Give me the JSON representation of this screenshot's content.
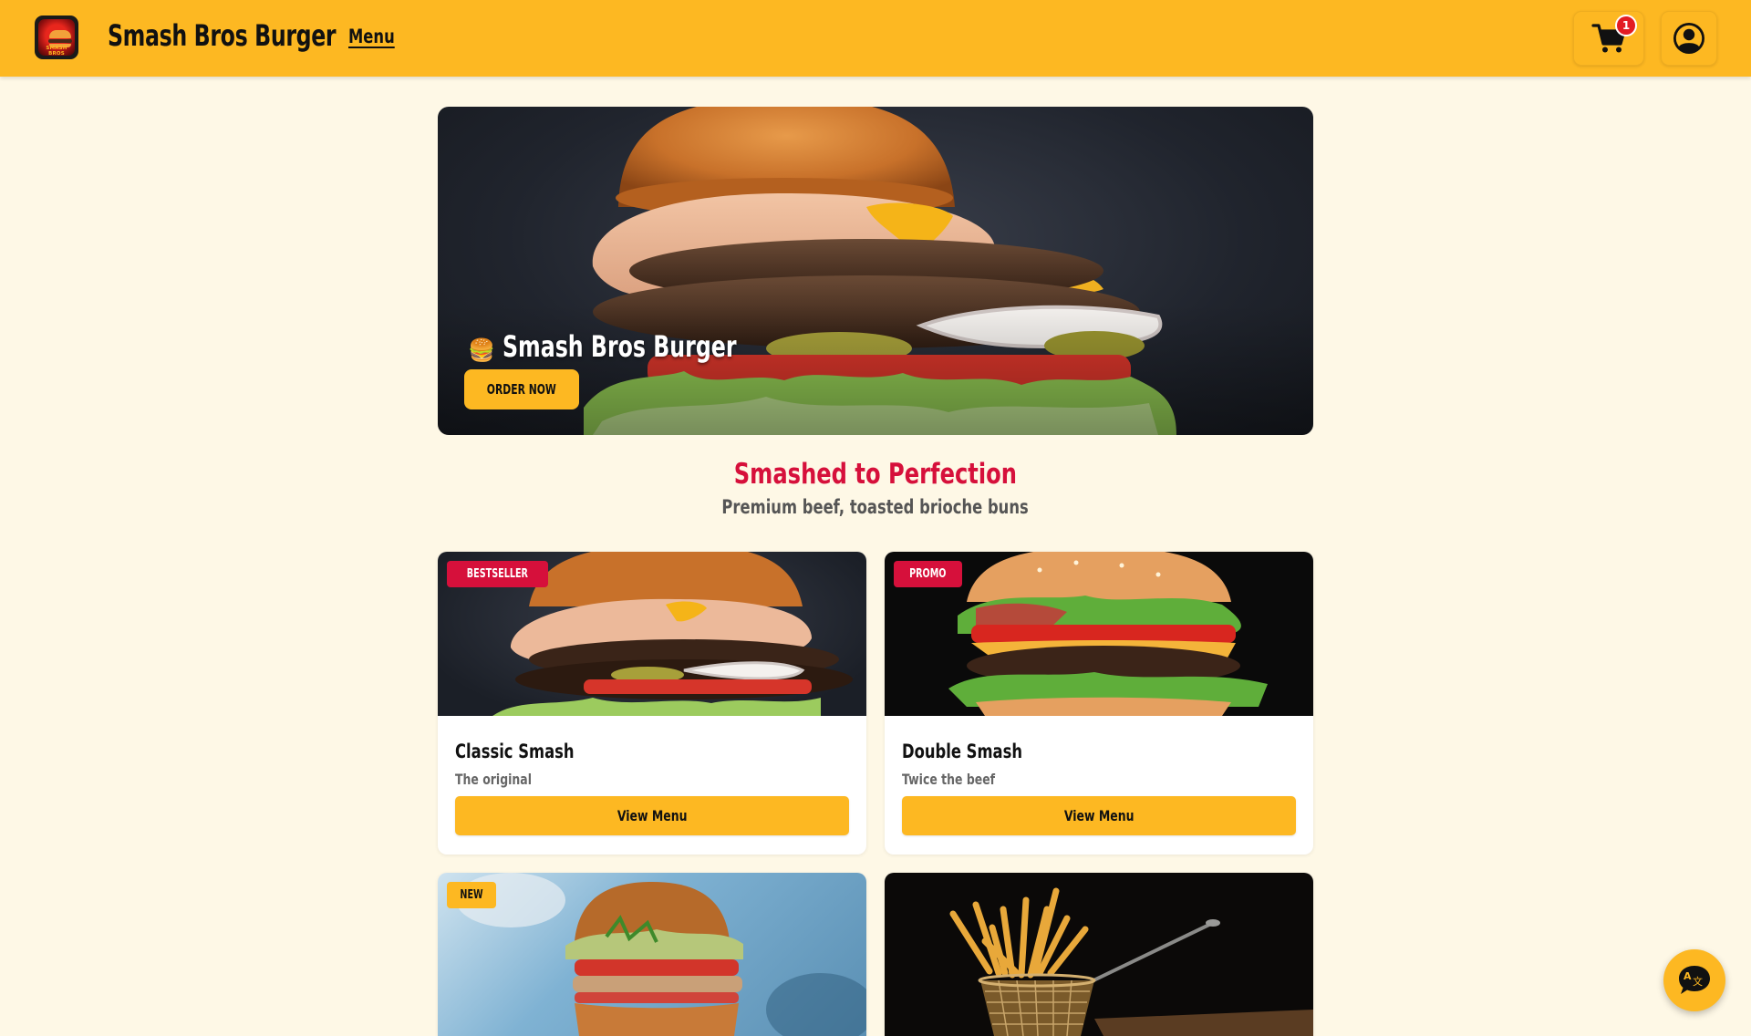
{
  "header": {
    "logo_text": "SMASH BROS",
    "brand": "Smash Bros Burger",
    "nav_menu": "Menu",
    "cart_count": "1",
    "icons": {
      "cart": "cart-icon",
      "profile": "user-icon"
    }
  },
  "hero": {
    "emoji": "🍔",
    "title": "Smash Bros Burger",
    "cta": "ORDER NOW"
  },
  "section": {
    "title": "Smashed to Perfection",
    "subtitle": "Premium beef, toasted brioche buns"
  },
  "cards": [
    {
      "badge": "BESTSELLER",
      "name": "Classic Smash",
      "desc": "The original",
      "button": "View Menu"
    },
    {
      "badge": "PROMO",
      "name": "Double Smash",
      "desc": "Twice the beef",
      "button": "View Menu"
    },
    {
      "badge": "NEW"
    },
    {}
  ],
  "colors": {
    "accent": "#FDB822",
    "brand_red": "#D6103B",
    "background": "#FEF8E6"
  },
  "fab": {
    "icon": "translate-icon"
  }
}
